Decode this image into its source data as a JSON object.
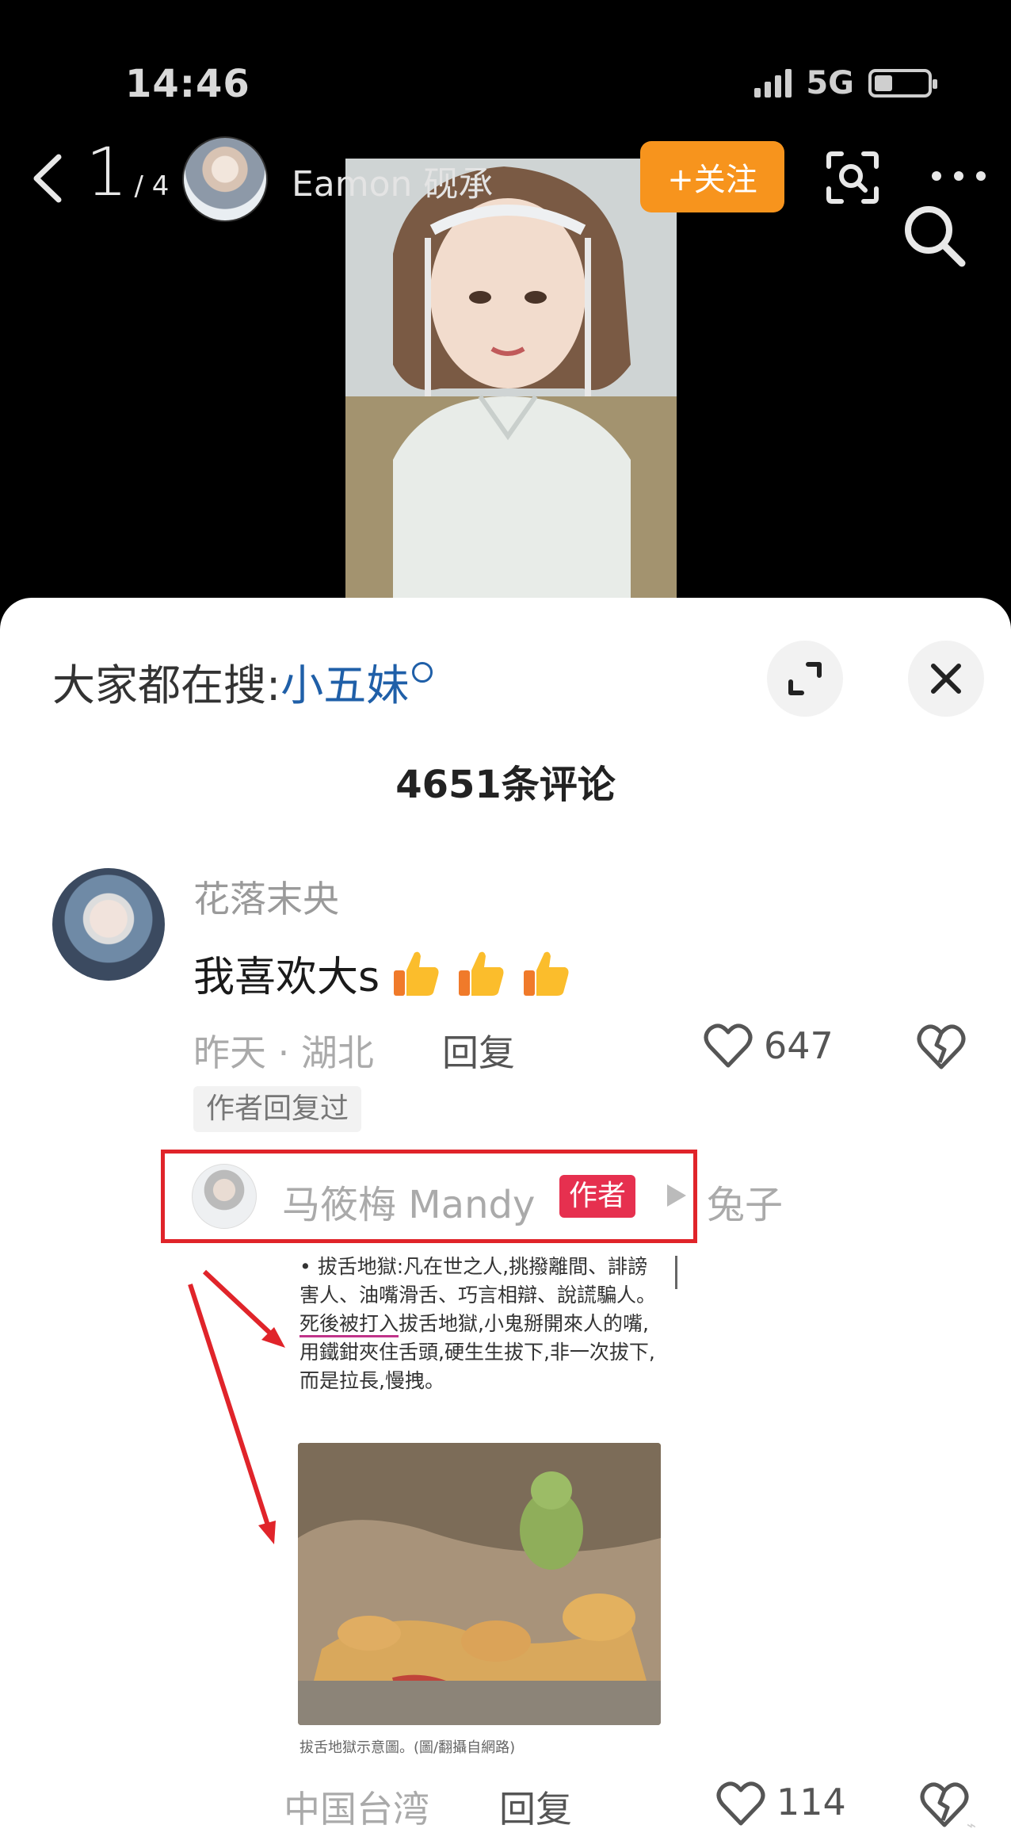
{
  "status_bar": {
    "time": "14:46",
    "network": "5G",
    "battery_level": 0.35
  },
  "header": {
    "page_current": "1",
    "page_total": "/ 4",
    "author_name": "Eamon 砚承",
    "follow_label": "+关注",
    "icons": [
      "back-icon",
      "scan-icon",
      "more-icon",
      "search-icon"
    ]
  },
  "comments_panel": {
    "search_prefix": "大家都在搜:",
    "search_term": "小五妹",
    "comment_count": "4651条评论",
    "comment": {
      "username": "花落末央",
      "text": "我喜欢大s",
      "emoji": "thumbs-up x3",
      "time_location": "昨天 · 湖北",
      "reply_label": "回复",
      "likes": "647",
      "author_replied_tag": "作者回复过"
    },
    "reply": {
      "username": "马筱梅 Mandy",
      "author_badge": "作者",
      "reply_to": "兔子",
      "scanned_text_pre": "拔舌地獄:凡在世之人,挑撥離間、誹謗害人、油嘴滑舌、巧言相辯、說謊騙人。",
      "scanned_text_underlined": "死後被打入",
      "scanned_text_post": "拔舌地獄,小鬼掰開來人的嘴,用鐵鉗夾住舌頭,硬生生拔下,非一次拔下,而是拉長,慢拽。",
      "image_caption": "拔舌地獄示意圖。(圖/翻攝自網路)",
      "location": "中国台湾",
      "reply_label": "回复",
      "likes": "114"
    }
  },
  "colors": {
    "follow_button": "#f7941d",
    "search_term": "#1f5fa8",
    "author_badge": "#e6304f",
    "annotation_red": "#e0242a"
  }
}
